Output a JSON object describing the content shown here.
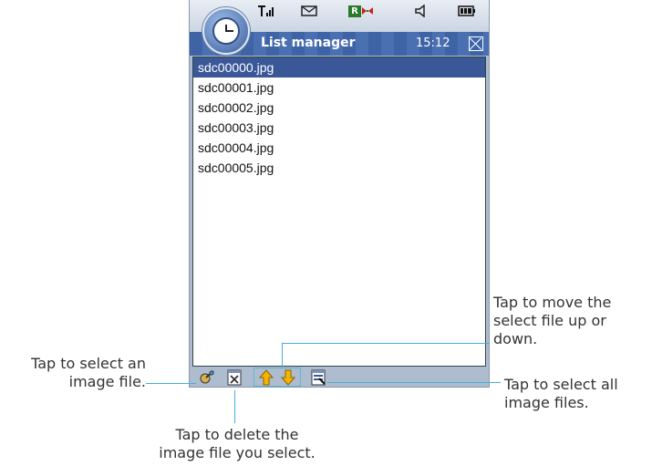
{
  "status_bar": {
    "icons": [
      "signal-icon",
      "mail-icon",
      "app-icon",
      "volume-icon",
      "battery-icon"
    ],
    "app_icon_letter": "R"
  },
  "title_bar": {
    "title": "List manager",
    "time": "15:12"
  },
  "files": [
    "sdc00000.jpg",
    "sdc00001.jpg",
    "sdc00002.jpg",
    "sdc00003.jpg",
    "sdc00004.jpg",
    "sdc00005.jpg"
  ],
  "callouts": {
    "select_line1": "Tap to select an",
    "select_line2": "image file.",
    "move_line1": "Tap to move the",
    "move_line2": "select file up or",
    "move_line3": "down.",
    "select_all_line1": "Tap to select all",
    "select_all_line2": "image files.",
    "delete_line1": "Tap to delete the",
    "delete_line2": "image file you select."
  },
  "colors": {
    "title_bar": "#3f64a6",
    "selection": "#3a5898",
    "callout_line": "#45afd2"
  }
}
